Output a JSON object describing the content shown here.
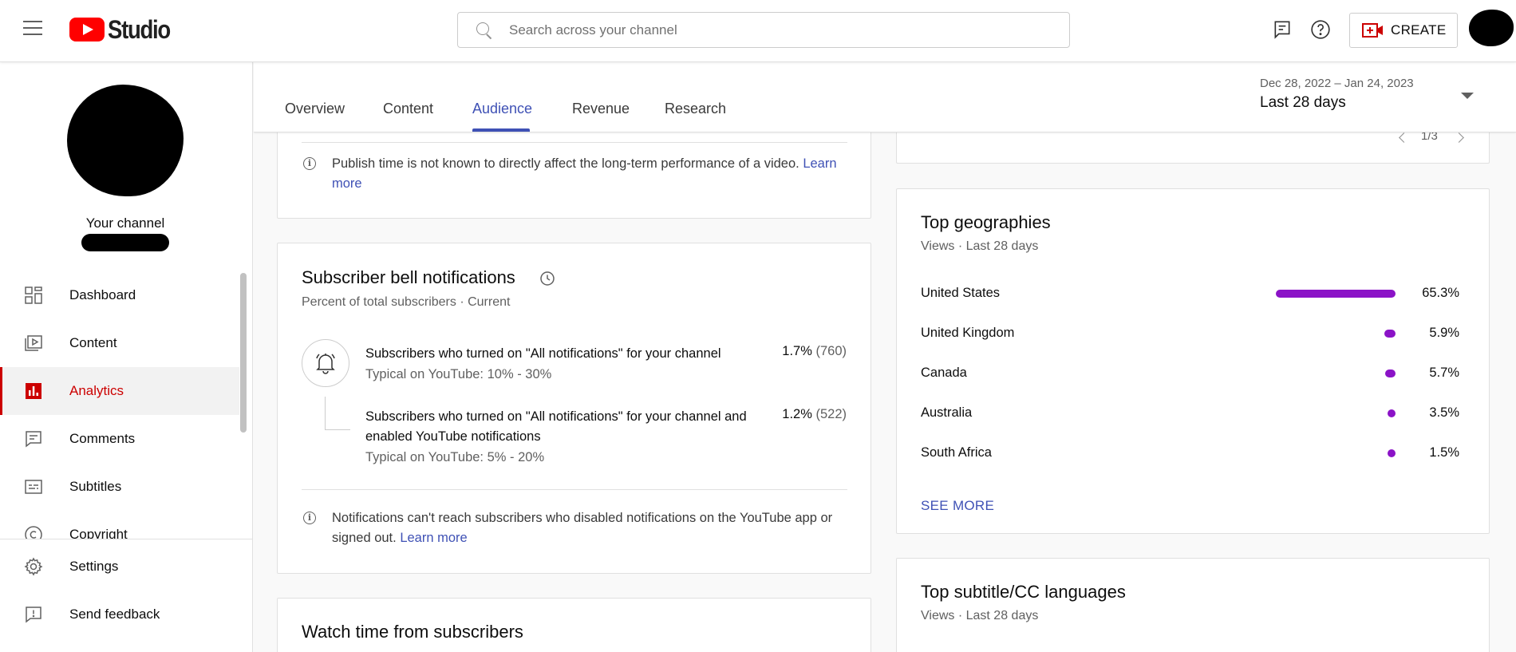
{
  "topbar": {
    "logo_text": "Studio",
    "search_placeholder": "Search across your channel",
    "create_label": "CREATE",
    "icons": [
      "menu-icon",
      "youtube-logo",
      "search-icon",
      "feedback-icon",
      "help-icon",
      "create-video-icon"
    ]
  },
  "sidebar": {
    "channel_label": "Your channel",
    "nav": [
      {
        "label": "Dashboard",
        "icon": "dashboard-icon"
      },
      {
        "label": "Content",
        "icon": "content-icon"
      },
      {
        "label": "Analytics",
        "icon": "analytics-icon",
        "active": true
      },
      {
        "label": "Comments",
        "icon": "comments-icon"
      },
      {
        "label": "Subtitles",
        "icon": "subtitles-icon"
      },
      {
        "label": "Copyright",
        "icon": "copyright-icon"
      }
    ],
    "bottom": [
      {
        "label": "Settings",
        "icon": "gear-icon"
      },
      {
        "label": "Send feedback",
        "icon": "feedback-icon"
      }
    ]
  },
  "tabs": {
    "items": [
      "Overview",
      "Content",
      "Audience",
      "Revenue",
      "Research"
    ],
    "active": "Audience",
    "date_range": "Dec 28, 2022 – Jan 24, 2023",
    "period": "Last 28 days"
  },
  "publish_card": {
    "note": "Publish time is not known to directly affect the long-term performance of a video.",
    "link": "Learn more"
  },
  "top_right_card": {
    "pager": "1/3"
  },
  "bell_card": {
    "title": "Subscriber bell notifications",
    "subtitle": "Percent of total subscribers · Current",
    "stats": [
      {
        "label": "Subscribers who turned on \"All notifications\" for your channel",
        "typical": "Typical on YouTube: 10% - 30%",
        "pct": "1.7%",
        "count": "(760)"
      },
      {
        "label": "Subscribers who turned on \"All notifications\" for your channel and enabled YouTube notifications",
        "typical": "Typical on YouTube: 5% - 20%",
        "pct": "1.2%",
        "count": "(522)"
      }
    ],
    "note": "Notifications can't reach subscribers who disabled notifications on the YouTube app or signed out.",
    "link": "Learn more"
  },
  "watch_card": {
    "title": "Watch time from subscribers"
  },
  "geo_card": {
    "title": "Top geographies",
    "subtitle": "Views · Last 28 days",
    "rows": [
      {
        "name": "United States",
        "pct": "65.3%",
        "value": 65.3
      },
      {
        "name": "United Kingdom",
        "pct": "5.9%",
        "value": 5.9
      },
      {
        "name": "Canada",
        "pct": "5.7%",
        "value": 5.7
      },
      {
        "name": "Australia",
        "pct": "3.5%",
        "value": 3.5
      },
      {
        "name": "South Africa",
        "pct": "1.5%",
        "value": 1.5
      }
    ],
    "see_more": "SEE MORE",
    "bar_color": "#8b13c7"
  },
  "subtitle_card": {
    "title": "Top subtitle/CC languages",
    "subtitle": "Views · Last 28 days"
  }
}
